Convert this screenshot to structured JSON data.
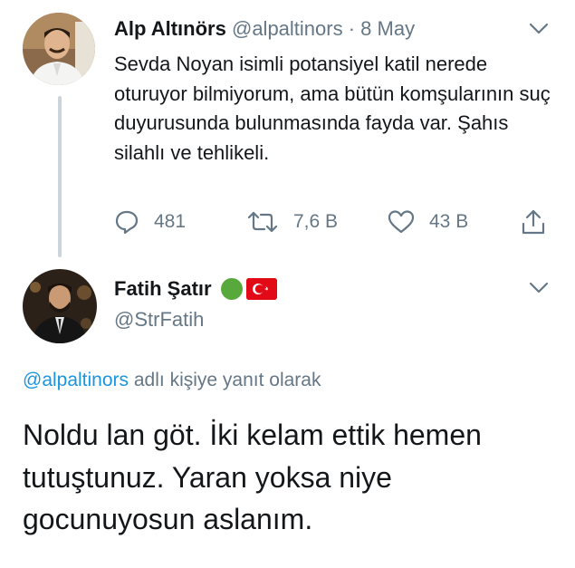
{
  "tweet1": {
    "author_name": "Alp Altınörs",
    "author_handle": "@alpaltinors",
    "separator": " · ",
    "date": "8 May",
    "text": "Sevda Noyan isimli potansiyel katil nerede oturuyor bilmiyorum, ama bütün komşularının suç duyurusunda bulunmasında fayda var. Şahıs silahlı ve tehlikeli.",
    "replies": "481",
    "retweets": "7,6 B",
    "likes": "43 B"
  },
  "tweet2": {
    "author_name": "Fatih Şatır",
    "author_handle": "@StrFatih",
    "reply_to_mention": "@alpaltinors",
    "reply_to_suffix": " adlı kişiye yanıt olarak",
    "text": "Noldu lan göt. İki kelam ettik hemen tutuştunuz. Yaran yoksa niye gocunuyosun aslanım."
  },
  "colors": {
    "text": "#14171a",
    "secondary": "#657786",
    "link": "#1b95e0",
    "thread_line": "#cdd5db",
    "badge_green": "#58a93c",
    "flag_red": "#e30a17"
  },
  "icons": [
    "reply-icon",
    "retweet-icon",
    "like-icon",
    "share-icon",
    "chevron-down-icon",
    "turkish-flag-icon"
  ]
}
